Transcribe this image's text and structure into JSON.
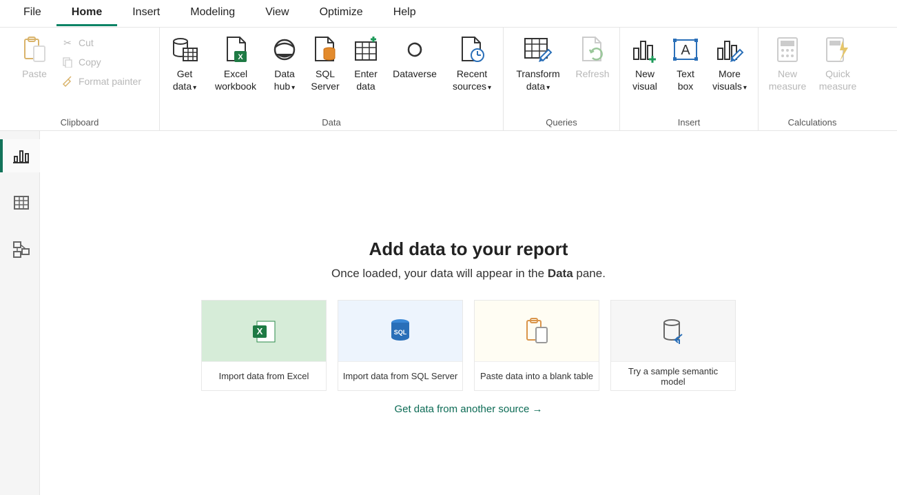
{
  "menu": {
    "file": "File",
    "home": "Home",
    "insert": "Insert",
    "modeling": "Modeling",
    "view": "View",
    "optimize": "Optimize",
    "help": "Help"
  },
  "ribbon": {
    "clipboard": {
      "label": "Clipboard",
      "paste": "Paste",
      "cut": "Cut",
      "copy": "Copy",
      "format_painter": "Format painter"
    },
    "data": {
      "label": "Data",
      "get_data": "Get data",
      "excel_workbook": "Excel workbook",
      "data_hub": "Data hub",
      "sql_server": "SQL Server",
      "enter_data": "Enter data",
      "dataverse": "Dataverse",
      "recent_sources": "Recent sources"
    },
    "queries": {
      "label": "Queries",
      "transform_data": "Transform data",
      "refresh": "Refresh"
    },
    "insert": {
      "label": "Insert",
      "new_visual": "New visual",
      "text_box": "Text box",
      "more_visuals": "More visuals"
    },
    "calculations": {
      "label": "Calculations",
      "new_measure": "New measure",
      "quick_measure": "Quick measure"
    }
  },
  "canvas": {
    "title": "Add data to your report",
    "subtitle_pre": "Once loaded, your data will appear in the ",
    "subtitle_bold": "Data",
    "subtitle_post": " pane.",
    "cards": {
      "excel": "Import data from Excel",
      "sql": "Import data from SQL Server",
      "paste": "Paste data into a blank table",
      "sample": "Try a sample semantic model"
    },
    "another_source": "Get data from another source →"
  }
}
